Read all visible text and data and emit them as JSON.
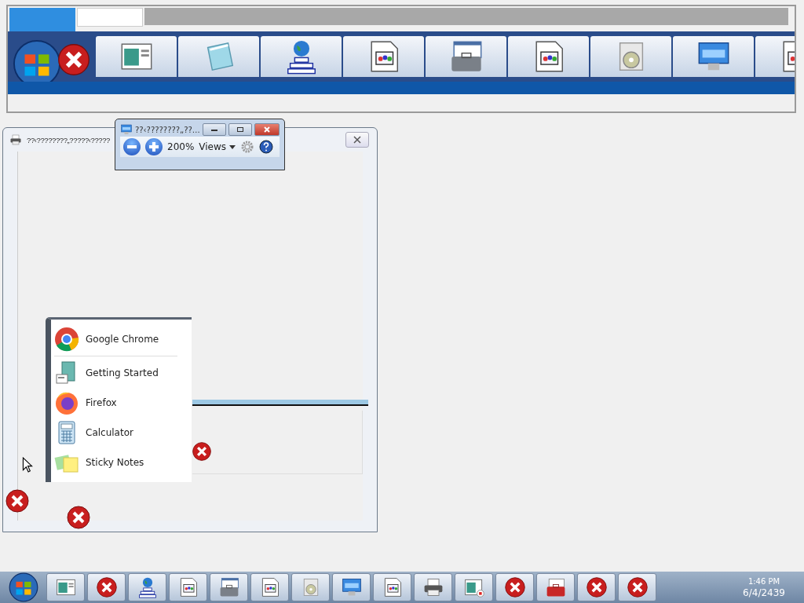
{
  "print_window": {
    "title": "??‹????????„?????‹?????"
  },
  "magnifier": {
    "title": "??‹????????„??…",
    "zoom": "200%",
    "views": "Views"
  },
  "start_menu": {
    "items": [
      {
        "label": "Google Chrome",
        "kind": "chrome"
      },
      {
        "label": "Getting Started",
        "kind": "guide"
      },
      {
        "label": "Firefox",
        "kind": "firefox"
      },
      {
        "label": "Calculator",
        "kind": "calculator"
      },
      {
        "label": "Sticky Notes",
        "kind": "notes"
      }
    ]
  },
  "clock": {
    "time": "1:46 PM",
    "date": "6/4/2439"
  }
}
